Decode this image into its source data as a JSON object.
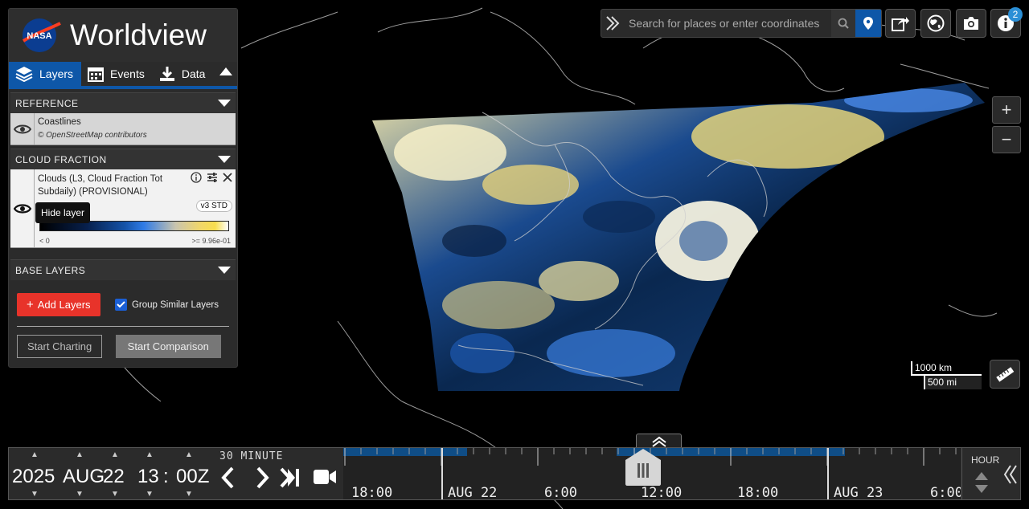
{
  "app": {
    "title": "Worldview",
    "logo_text": "NASA"
  },
  "tabs": [
    {
      "label": "Layers",
      "icon": "layers-icon",
      "active": true
    },
    {
      "label": "Events",
      "icon": "calendar-icon"
    },
    {
      "label": "Data",
      "icon": "download-icon"
    }
  ],
  "groups": {
    "reference": {
      "title": "REFERENCE",
      "layer_title": "Coastlines",
      "layer_attribution": "© OpenStreetMap contributors"
    },
    "cloud_fraction": {
      "title": "CLOUD FRACTION",
      "layer_title_line1": "Clouds (L3, Cloud Fraction Tot",
      "layer_title_line2": "Subdaily) (PROVISIONAL)",
      "version_badge": "v3 STD",
      "legend_min": "< 0",
      "legend_max": ">= 9.96e-01",
      "tooltip": "Hide layer"
    },
    "base": {
      "title": "BASE LAYERS"
    }
  },
  "actions": {
    "add_layers": "Add Layers",
    "group_similar": "Group Similar Layers",
    "start_charting": "Start Charting",
    "start_comparison": "Start Comparison"
  },
  "search": {
    "placeholder": "Search for places or enter coordinates"
  },
  "notifications": {
    "count": "2"
  },
  "scale": {
    "km": "1000 km",
    "mi": "500 mi"
  },
  "timeline": {
    "year": "2025",
    "month": "AUG",
    "day": "22",
    "hour": "13",
    "minute": "00Z",
    "separator": ":",
    "interval": "30 MINUTE",
    "zoom_level": "HOUR",
    "axis_labels": [
      "18:00",
      "AUG 22",
      "6:00",
      "12:00",
      "18:00",
      "AUG 23",
      "6:00"
    ]
  },
  "colors": {
    "accent": "#0e57a8",
    "add_button": "#e8332a"
  }
}
